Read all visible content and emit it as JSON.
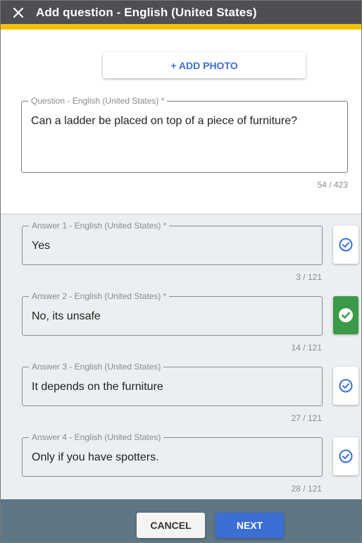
{
  "header": {
    "title": "Add question - English (United States)",
    "close_icon": "close-icon"
  },
  "photo": {
    "add_label": "+ ADD PHOTO"
  },
  "question": {
    "label": "Question - English (United States) *",
    "value": "Can a ladder be placed on top of a piece of furniture?",
    "counter": "54 / 423"
  },
  "answers": [
    {
      "label": "Answer 1 - English (United States) *",
      "value": "Yes",
      "counter": "3 / 121",
      "correct": false
    },
    {
      "label": "Answer 2 - English (United States) *",
      "value": "No, its unsafe",
      "counter": "14 / 121",
      "correct": true
    },
    {
      "label": "Answer 3 - English (United States)",
      "value": "It depends on the furniture",
      "counter": "27 / 121",
      "correct": false
    },
    {
      "label": "Answer 4 - English (United States)",
      "value": "Only if you have spotters.",
      "counter": "28 / 121",
      "correct": false
    }
  ],
  "footer": {
    "cancel_label": "CANCEL",
    "next_label": "NEXT"
  },
  "colors": {
    "header_bg": "#4d4f53",
    "accent": "#f2c200",
    "primary": "#3b6fd4",
    "correct": "#3a9a47",
    "footer_bg": "#5f7784"
  }
}
